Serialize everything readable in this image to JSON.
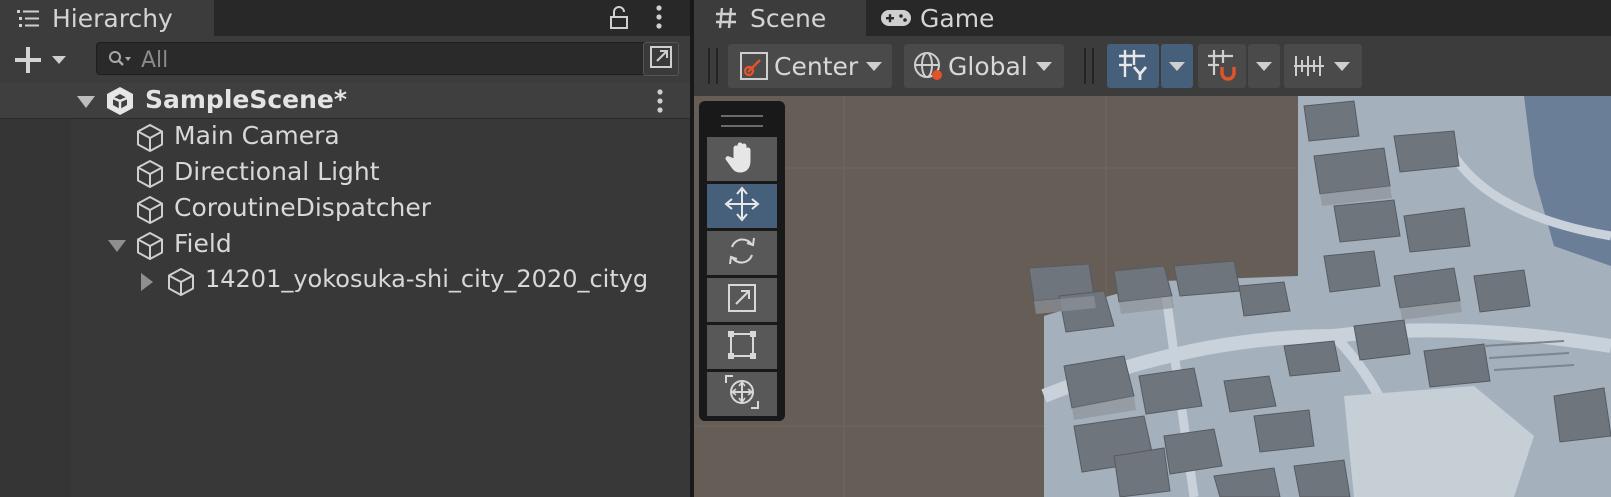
{
  "hierarchy": {
    "tab_title": "Hierarchy",
    "search": {
      "value": "",
      "placeholder": "All"
    },
    "scene": {
      "name": "SampleScene*"
    },
    "items": [
      {
        "label": "Main Camera"
      },
      {
        "label": "Directional Light"
      },
      {
        "label": "CoroutineDispatcher"
      },
      {
        "label": "Field"
      },
      {
        "label": "14201_yokosuka-shi_city_2020_cityg"
      }
    ]
  },
  "scene_view": {
    "tabs": [
      {
        "label": "Scene",
        "icon": "grid-hash-icon"
      },
      {
        "label": "Game",
        "icon": "gamepad-icon"
      }
    ],
    "toolbar": {
      "pivot_label": "Center",
      "space_label": "Global"
    },
    "tools": [
      "hand-tool",
      "move-tool",
      "rotate-tool",
      "scale-tool",
      "rect-tool",
      "transform-tool"
    ],
    "active_tool": "move-tool"
  },
  "colors": {
    "accent_blue": "#46607c",
    "viewport_bg": "#665d57",
    "panel_bg": "#383838",
    "snap_orange": "#e2542a"
  }
}
